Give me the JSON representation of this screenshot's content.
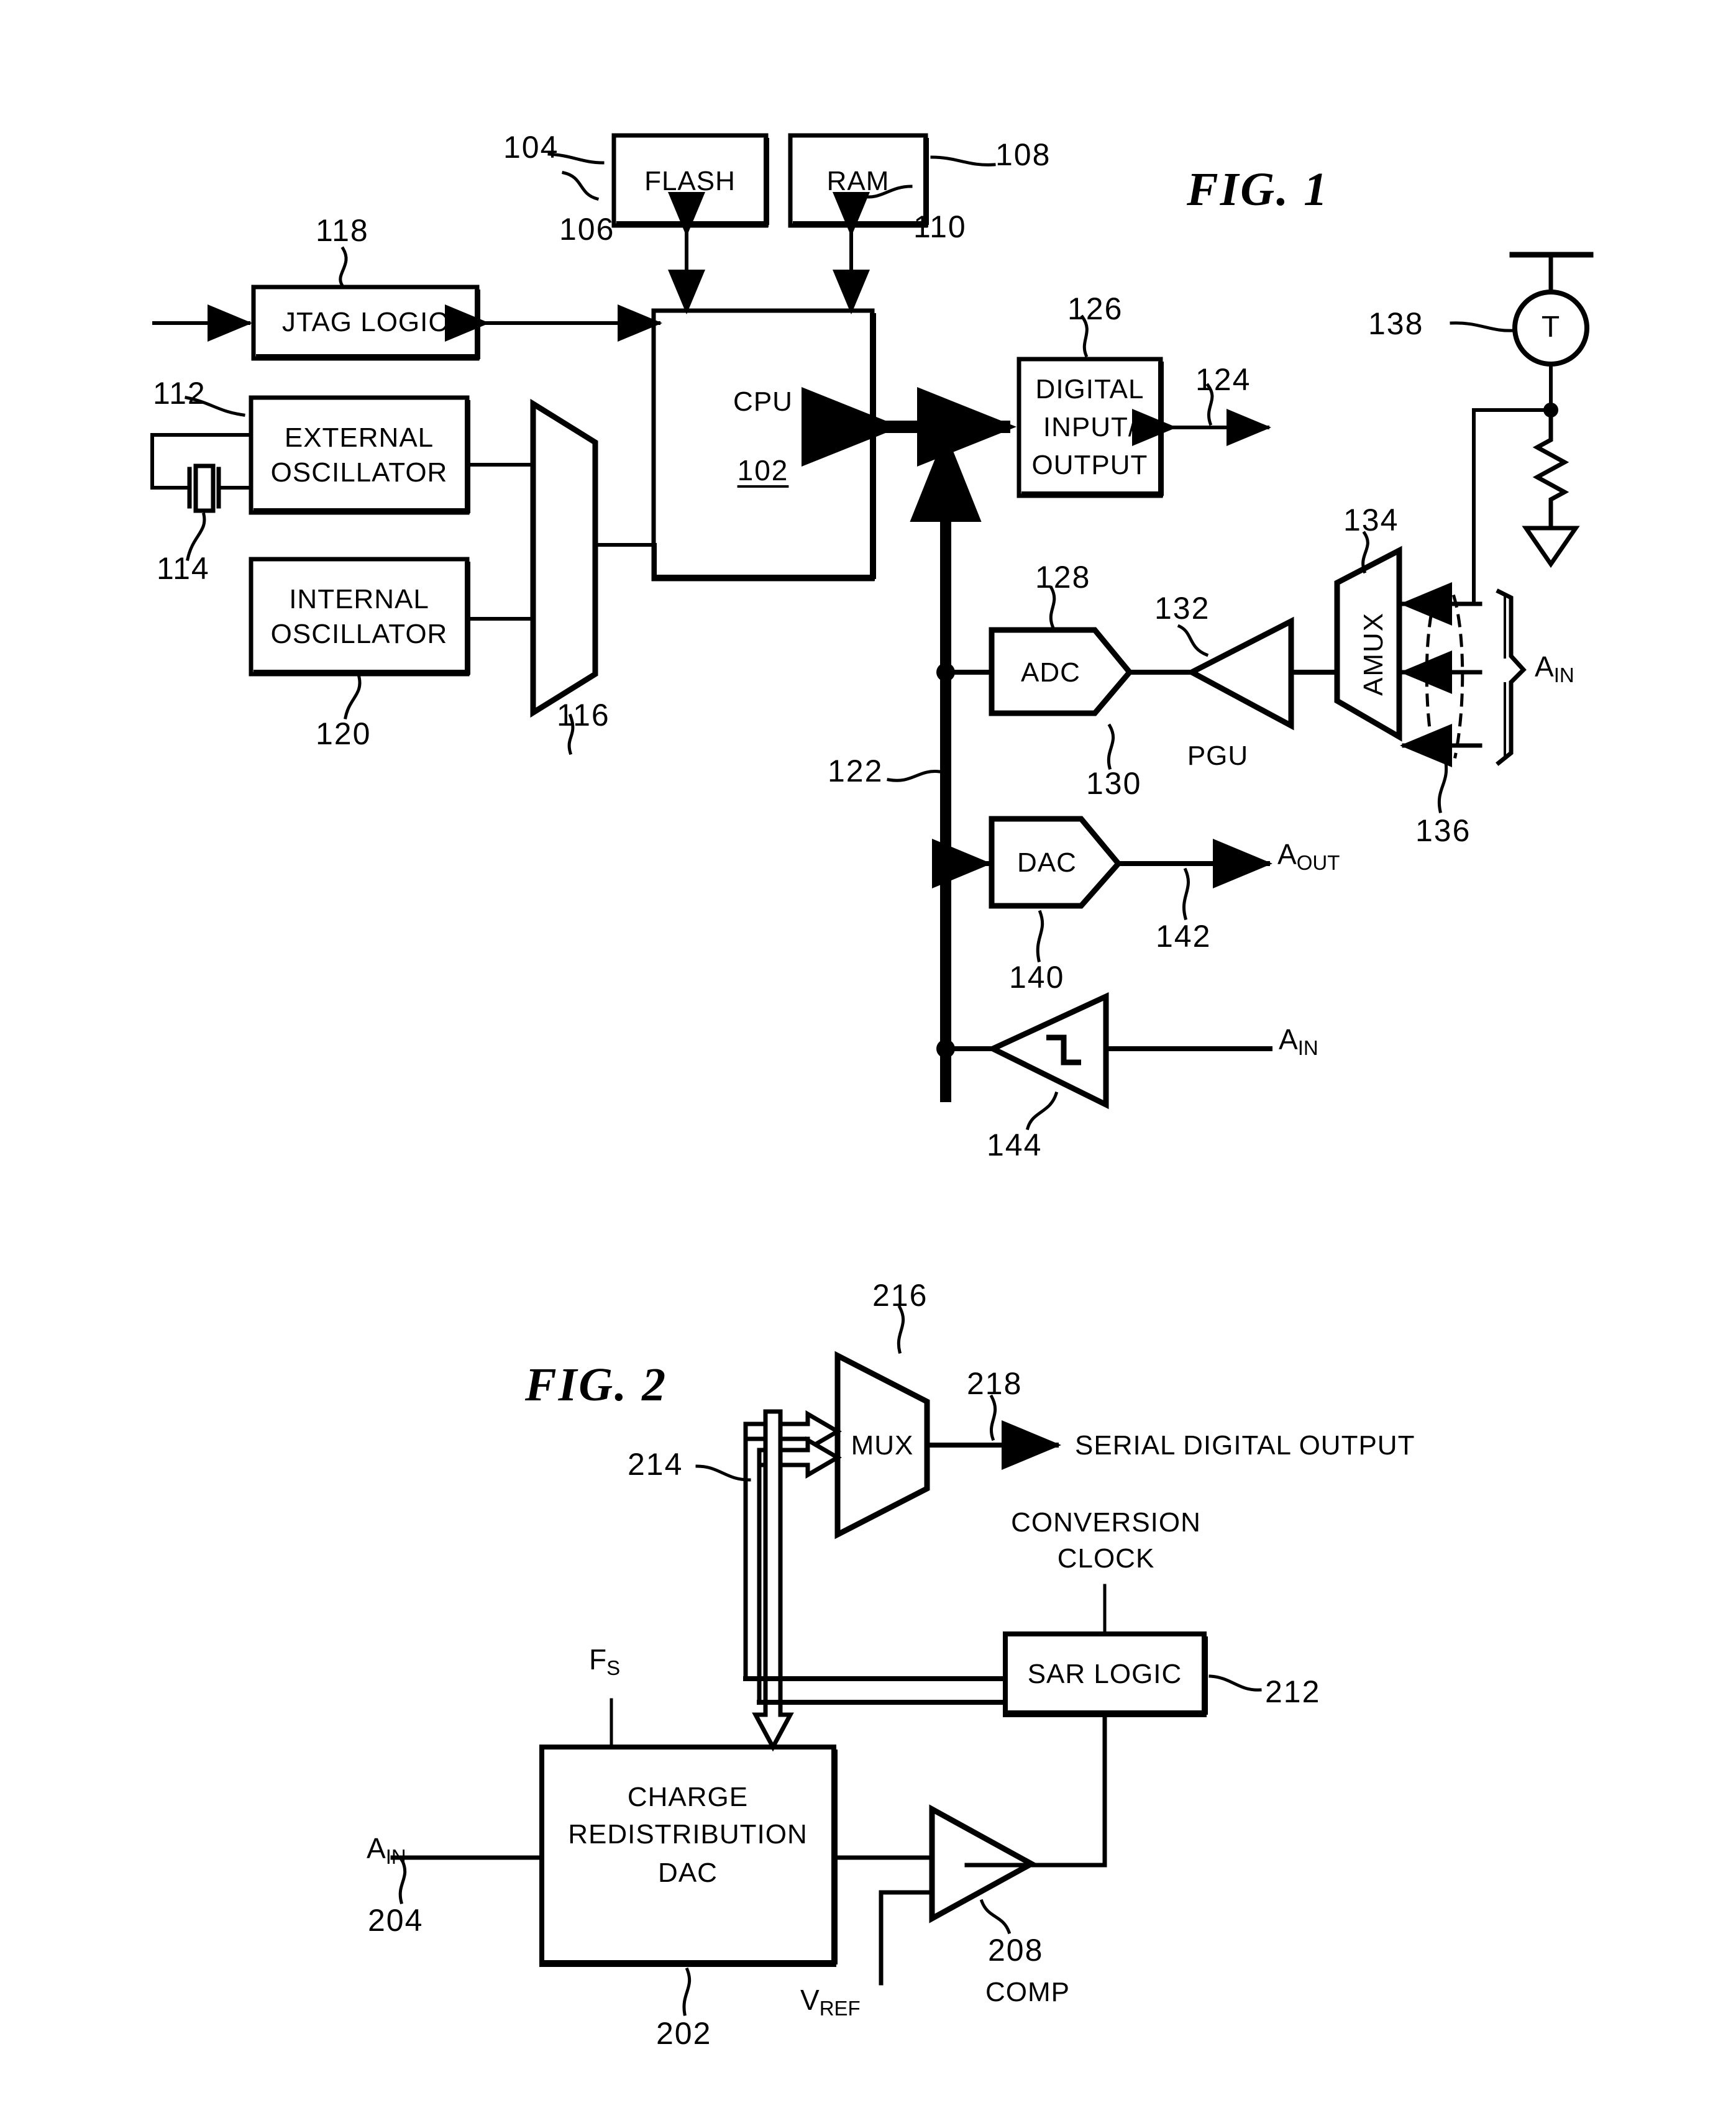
{
  "figures": [
    {
      "title": "FIG. 1",
      "blocks": [
        {
          "name": "flash",
          "label": "FLASH",
          "ref": "104"
        },
        {
          "name": "ram",
          "label": "RAM",
          "ref": "108"
        },
        {
          "name": "jtag-logic",
          "label": "JTAG LOGIC",
          "ref": "118"
        },
        {
          "name": "external-oscillator",
          "label": "EXTERNAL\nOSCILLATOR",
          "ref": "112"
        },
        {
          "name": "internal-oscillator",
          "label": "INTERNAL\nOSCILLATOR",
          "ref": "120"
        },
        {
          "name": "clock-mux",
          "label": "",
          "ref": "116"
        },
        {
          "name": "cpu",
          "label": "CPU",
          "ref": "102"
        },
        {
          "name": "digital-io",
          "label": "DIGITAL\nINPUT/\nOUTPUT",
          "ref": "126"
        },
        {
          "name": "adc",
          "label": "ADC",
          "ref": "128"
        },
        {
          "name": "pgu",
          "label": "PGU",
          "ref": "132"
        },
        {
          "name": "amux",
          "label": "AMUX",
          "ref": "134"
        },
        {
          "name": "dac",
          "label": "DAC",
          "ref": "140"
        },
        {
          "name": "comparator",
          "label": "",
          "ref": "144"
        },
        {
          "name": "temperature-sensor",
          "label": "T",
          "ref": "138"
        }
      ],
      "ref_numbers": [
        "104",
        "106",
        "108",
        "110",
        "112",
        "114",
        "116",
        "118",
        "120",
        "122",
        "124",
        "126",
        "128",
        "130",
        "132",
        "134",
        "136",
        "138",
        "140",
        "142",
        "144"
      ],
      "signal_labels": [
        {
          "base": "A",
          "sub": "IN",
          "name": "amux-ain-label"
        },
        {
          "base": "A",
          "sub": "OUT",
          "name": "dac-aout-label"
        },
        {
          "base": "A",
          "sub": "IN",
          "name": "comparator-ain-label"
        }
      ]
    },
    {
      "title": "FIG. 2",
      "blocks": [
        {
          "name": "mux",
          "label": "MUX",
          "ref": "216"
        },
        {
          "name": "sar-logic",
          "label": "SAR LOGIC",
          "ref": "212"
        },
        {
          "name": "charge-redistribution-dac",
          "label": "CHARGE\nREDISTRIBUTION\nDAC",
          "ref": "202"
        },
        {
          "name": "comparator",
          "label": "COMP",
          "ref": "208"
        }
      ],
      "text_labels": [
        {
          "name": "serial-digital-output-label",
          "text": "SERIAL DIGITAL OUTPUT"
        },
        {
          "name": "conversion-clock-label",
          "text": "CONVERSION\nCLOCK"
        },
        {
          "name": "comp-label",
          "text": "COMP"
        }
      ],
      "ref_numbers": [
        "202",
        "204",
        "208",
        "212",
        "214",
        "216",
        "218"
      ],
      "signal_labels": [
        {
          "base": "F",
          "sub": "S",
          "name": "fs-label"
        },
        {
          "base": "A",
          "sub": "IN",
          "name": "ain-label"
        },
        {
          "base": "V",
          "sub": "REF",
          "name": "vref-label"
        }
      ]
    }
  ],
  "fig1": {
    "title": "FIG. 1",
    "flash": "FLASH",
    "ram": "RAM",
    "jtag": "JTAG LOGIC",
    "ext_osc_l1": "EXTERNAL",
    "ext_osc_l2": "OSCILLATOR",
    "int_osc_l1": "INTERNAL",
    "int_osc_l2": "OSCILLATOR",
    "cpu": "CPU",
    "cpu_ref": "102",
    "dio_l1": "DIGITAL",
    "dio_l2": "INPUT/",
    "dio_l3": "OUTPUT",
    "adc": "ADC",
    "pgu": "PGU",
    "amux": "AMUX",
    "dac": "DAC",
    "tsense": "T",
    "n104": "104",
    "n106": "106",
    "n108": "108",
    "n110": "110",
    "n112": "112",
    "n114": "114",
    "n116": "116",
    "n118": "118",
    "n120": "120",
    "n122": "122",
    "n124": "124",
    "n126": "126",
    "n128": "128",
    "n130": "130",
    "n132": "132",
    "n134": "134",
    "n136": "136",
    "n138": "138",
    "n140": "140",
    "n142": "142",
    "n144": "144",
    "ain_base": "A",
    "ain_sub": "IN",
    "aout_base": "A",
    "aout_sub": "OUT"
  },
  "fig2": {
    "title": "FIG. 2",
    "mux": "MUX",
    "serial_out": "SERIAL DIGITAL OUTPUT",
    "conv_clock_l1": "CONVERSION",
    "conv_clock_l2": "CLOCK",
    "sar": "SAR LOGIC",
    "crdac_l1": "CHARGE",
    "crdac_l2": "REDISTRIBUTION",
    "crdac_l3": "DAC",
    "comp": "COMP",
    "n202": "202",
    "n204": "204",
    "n208": "208",
    "n212": "212",
    "n214": "214",
    "n216": "216",
    "n218": "218",
    "fs_base": "F",
    "fs_sub": "S",
    "ain_base": "A",
    "ain_sub": "IN",
    "vref_base": "V",
    "vref_sub": "REF"
  }
}
